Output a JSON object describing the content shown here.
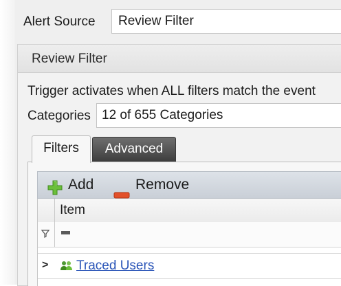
{
  "alert_source": {
    "label": "Alert Source",
    "value": "Review Filter"
  },
  "panel": {
    "title": "Review Filter",
    "trigger_text": "Trigger activates when ALL filters match the event",
    "categories": {
      "label": "Categories",
      "value": "12 of 655 Categories"
    },
    "tabs": [
      {
        "label": "Filters",
        "active": true
      },
      {
        "label": "Advanced",
        "active": false
      }
    ],
    "toolbar": {
      "add_label": "Add",
      "remove_label": "Remove"
    },
    "grid": {
      "columns": [
        "Item"
      ],
      "rows": [
        {
          "label": "Traced Users",
          "expandable": true,
          "icon": "user-group-icon"
        }
      ]
    }
  },
  "colors": {
    "add_icon": "#6bbf3a",
    "remove_icon": "#e2502a",
    "link": "#2a55b8",
    "active_tab_dark": "#4a4a4a"
  }
}
